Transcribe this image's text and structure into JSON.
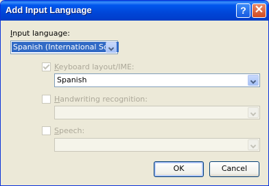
{
  "window": {
    "title": "Add Input Language",
    "help_label": "?",
    "close_label": "✕"
  },
  "input_language": {
    "label_u": "I",
    "label_rest": "nput language:",
    "value": "Spanish (International Sort)"
  },
  "keyboard": {
    "checked": true,
    "label_u": "K",
    "label_rest": "eyboard layout/IME:",
    "value": "Spanish"
  },
  "handwriting": {
    "checked": false,
    "label_u": "H",
    "label_rest": "andwriting recognition:",
    "value": ""
  },
  "speech": {
    "checked": false,
    "label_u": "S",
    "label_rest": "peech:",
    "value": ""
  },
  "buttons": {
    "ok": "OK",
    "cancel": "Cancel"
  },
  "icons": {
    "help": "help-icon",
    "close": "close-icon",
    "dropdown": "chevron-down-icon",
    "check": "checkmark-icon"
  },
  "colors": {
    "titlebar": "#0058EE",
    "dialog_bg": "#ECE9D8",
    "selection": "#316AC5",
    "disabled_text": "#ACA899"
  }
}
